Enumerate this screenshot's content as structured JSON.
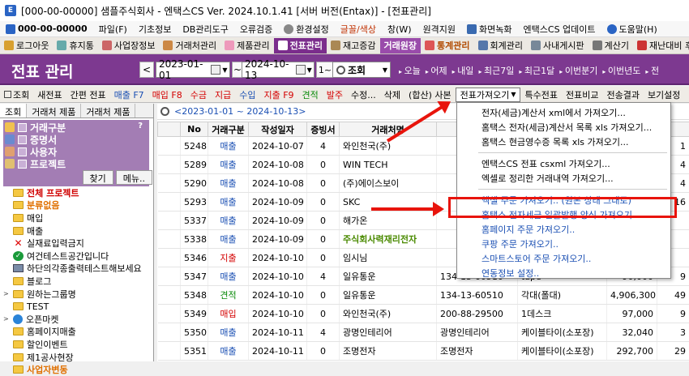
{
  "window": {
    "title": "[000-00-00000] 샘플주식회사 - 엔택스CS Ver. 2024.10.1.41 [서버 버전(Entax)] - [전표관리]"
  },
  "menu": [
    "000-00-00000",
    "파일(F)",
    "기초정보",
    "DB관리도구",
    "오류검증",
    "환경설정",
    "글꼴/색상",
    "창(W)",
    "원격지원",
    "화면녹화",
    "엔택스CS 업데이트",
    "도움말(H)"
  ],
  "quick": [
    "로그아웃",
    "휴지통",
    "사업장정보",
    "거래처관리",
    "제품관리",
    "전표관리",
    "재고증감",
    "거래원장",
    "통계관리",
    "회계관리",
    "사내게시판",
    "계산기",
    "재난대비 후원"
  ],
  "header": {
    "title": "전표 관리",
    "date_from": "2023-01-01",
    "date_to": "2024-10-13",
    "range_btn": "1~",
    "search": "조회",
    "periods": [
      "오늘",
      "어제",
      "내일",
      "최근7일",
      "최근1달",
      "이번분기",
      "이번년도",
      "전"
    ]
  },
  "toolbar": [
    "조회",
    "새전표",
    "간편 전표",
    "매출 F7",
    "매입 F8",
    "수금",
    "지급",
    "수입",
    "지출 F9",
    "견적",
    "발주",
    "수정...",
    "삭제",
    "(합산) 사본",
    "전표가져오기",
    "특수전표",
    "전표비교",
    "전송결과",
    "보기설정"
  ],
  "left": {
    "tabs": [
      "조회",
      "거래처 제품",
      "거래처 제품"
    ],
    "groups": [
      "거래구분",
      "증명서",
      "사용자",
      "프로젝트"
    ],
    "find": "찾기",
    "menu": "메뉴..",
    "tree": [
      "전체 프로젝트",
      "분류없음",
      "매입",
      "매출",
      "실재료입력금지",
      "여건테스트공간입니다",
      "하단의각종출력테스트해보세요",
      "블로그",
      "원하는그룹명",
      "TEST",
      "오픈마켓",
      "홈페이지매출",
      "할인이벤트",
      "제1공사현장",
      "사업자변동"
    ]
  },
  "grid": {
    "period": "<2023-01-01 ~ 2024-10-13>",
    "columns": [
      "",
      "No",
      "거래구분",
      "작성일자",
      "증빙서",
      "거래처명",
      "",
      "",
      ""
    ],
    "rows": [
      [
        "5248",
        "매출",
        "2024-10-07",
        "4",
        "와인천국(주)",
        "",
        "",
        "68",
        "1"
      ],
      [
        "5289",
        "매출",
        "2024-10-08",
        "0",
        "WIN TECH",
        "",
        "",
        "60",
        "4"
      ],
      [
        "5290",
        "매출",
        "2024-10-08",
        "0",
        "(주)에이스보이",
        "",
        "",
        "00",
        "4"
      ],
      [
        "5293",
        "매출",
        "2024-10-09",
        "0",
        "SKC",
        "",
        "",
        "00",
        "16"
      ],
      [
        "5337",
        "매출",
        "2024-10-09",
        "0",
        "해가온",
        "",
        "",
        "00",
        ""
      ],
      [
        "5338",
        "매출",
        "2024-10-09",
        "0",
        "주식회사력재리전자",
        "",
        "",
        "00",
        ""
      ],
      [
        "5346",
        "지출",
        "2024-10-10",
        "0",
        "임시님",
        "",
        "",
        "00",
        ""
      ],
      [
        "5347",
        "매출",
        "2024-10-10",
        "4",
        "일유통운",
        "134-13-60510",
        "tape",
        "90,000",
        "9"
      ],
      [
        "5348",
        "견적",
        "2024-10-10",
        "0",
        "일유통운",
        "134-13-60510",
        "각대(폴대)",
        "4,906,300",
        "49"
      ],
      [
        "5349",
        "매입",
        "2024-10-10",
        "0",
        "와인천국(주)",
        "200-88-29500",
        "1데스크",
        "97,000",
        "9"
      ],
      [
        "5350",
        "매출",
        "2024-10-11",
        "4",
        "광명인테리어",
        "광명인테리어",
        "케이블타이(소포장)",
        "32,040",
        "3"
      ],
      [
        "5351",
        "매출",
        "2024-10-11",
        "0",
        "조명전자",
        "조명전자",
        "케이블타이(소포장)",
        "292,700",
        "29"
      ]
    ]
  },
  "dropdown": {
    "items": [
      "전자(세금)계산서 xml에서 가져오기...",
      "홈택스 전자(세금)계산서 목록 xls 가져오기...",
      "홈택스 현금영수증 목록 xls 가져오기...",
      "엔택스CS 전표 csxml 가져오기...",
      "엑셀로 정리한 거래내역 가져오기...",
      "엑셀 주문 가져오기.. (원본 상태 그대로)",
      "홈택스 전자세금 일괄발행 양식 가져오기..",
      "홈페이지 주문 가져오기..",
      "쿠팡 주문 가져오기..",
      "스마트스토어 주문 가져오기..",
      "연동정보 설정.."
    ]
  },
  "colors": {
    "purple": "#7d3990",
    "red": "#e8140c",
    "blue": "#1a4fb3"
  }
}
